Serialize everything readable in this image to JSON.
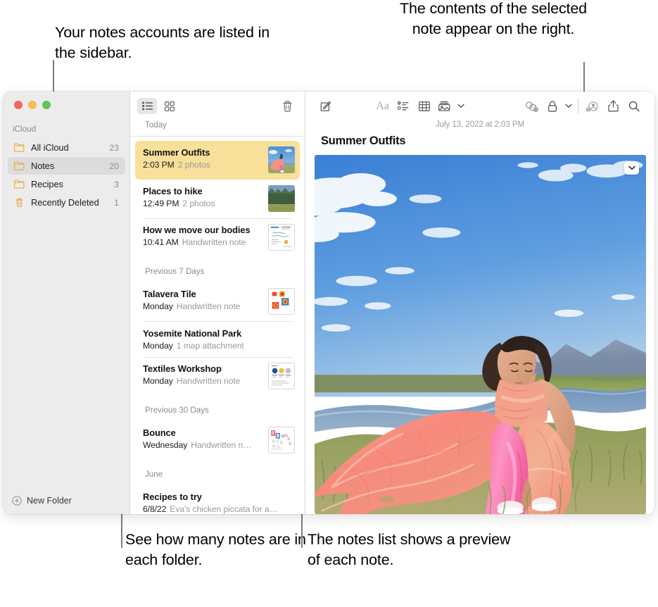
{
  "callouts": [
    {
      "id": "sidebar-callout",
      "text": "Your notes accounts are listed in the sidebar."
    },
    {
      "id": "detail-callout",
      "text": "The contents of the selected note appear on the right."
    },
    {
      "id": "counts-callout",
      "text": "See how many notes are in each folder."
    },
    {
      "id": "preview-callout",
      "text": "The notes list shows a preview of each note."
    }
  ],
  "window": {
    "traffic_lights": {
      "close": "close-button",
      "minimize": "minimize-button",
      "zoom": "zoom-button",
      "close_color": "#ed6a5e",
      "minimize_color": "#f5bd4f",
      "zoom_color": "#61c554"
    }
  },
  "sidebar": {
    "account_label": "iCloud",
    "folders": [
      {
        "name": "All iCloud",
        "count": "23",
        "icon": "folder-icon",
        "selected": false
      },
      {
        "name": "Notes",
        "count": "20",
        "icon": "folder-icon",
        "selected": true
      },
      {
        "name": "Recipes",
        "count": "3",
        "icon": "folder-icon",
        "selected": false
      },
      {
        "name": "Recently Deleted",
        "count": "1",
        "icon": "trash-icon",
        "selected": false
      }
    ],
    "new_folder_label": "New Folder",
    "new_folder_icon": "plus-circle-icon",
    "folder_color": "#e8b44b"
  },
  "notelist": {
    "toolbar": {
      "list_view_icon": "list-view-icon",
      "gallery_view_icon": "gallery-view-icon",
      "delete_icon": "trash-icon",
      "active_view": "list"
    },
    "sections": [
      {
        "heading": "Today",
        "notes": [
          {
            "title": "Summer Outfits",
            "time": "2:03 PM",
            "preview": "2 photos",
            "thumb": "photo-woman-pink-dress",
            "selected": true
          },
          {
            "title": "Places to hike",
            "time": "12:49 PM",
            "preview": "2 photos",
            "thumb": "photo-forest-meadow",
            "selected": false
          },
          {
            "title": "How we move our bodies",
            "time": "10:41 AM",
            "preview": "Handwritten note",
            "thumb": "doc-handwritten-diagram",
            "selected": false
          }
        ]
      },
      {
        "heading": "Previous 7 Days",
        "notes": [
          {
            "title": "Talavera Tile",
            "time": "Monday",
            "preview": "Handwritten note",
            "thumb": "doc-tile-sketch",
            "selected": false
          },
          {
            "title": "Yosemite National Park",
            "time": "Monday",
            "preview": "1 map attachment",
            "thumb": "none",
            "selected": false
          },
          {
            "title": "Textiles Workshop",
            "time": "Monday",
            "preview": "Handwritten note",
            "thumb": "doc-textiles-chart",
            "selected": false
          }
        ]
      },
      {
        "heading": "Previous 30 Days",
        "notes": [
          {
            "title": "Bounce",
            "time": "Wednesday",
            "preview": "Handwritten n…",
            "thumb": "doc-bounce-lettering",
            "selected": false
          }
        ]
      },
      {
        "heading": "June",
        "notes": [
          {
            "title": "Recipes to try",
            "time": "6/8/22",
            "preview": "Eva's chicken piccata for a…",
            "thumb": "none",
            "selected": false
          }
        ]
      }
    ],
    "selection_color": "#f8e09a"
  },
  "detail": {
    "toolbar_icons": [
      "compose-icon",
      "format-aa-icon",
      "checklist-icon",
      "table-icon",
      "media-icon",
      "media-chevron-down-icon",
      "link-icon",
      "lock-icon",
      "lock-chevron-down-icon",
      "collaborate-icon",
      "share-icon",
      "search-icon"
    ],
    "date": "July 13, 2022 at 2:03 PM",
    "title": "Summer Outfits",
    "photo_alt": "photo-woman-pink-dress-by-river",
    "photo_menu_icon": "chevron-down-icon"
  }
}
